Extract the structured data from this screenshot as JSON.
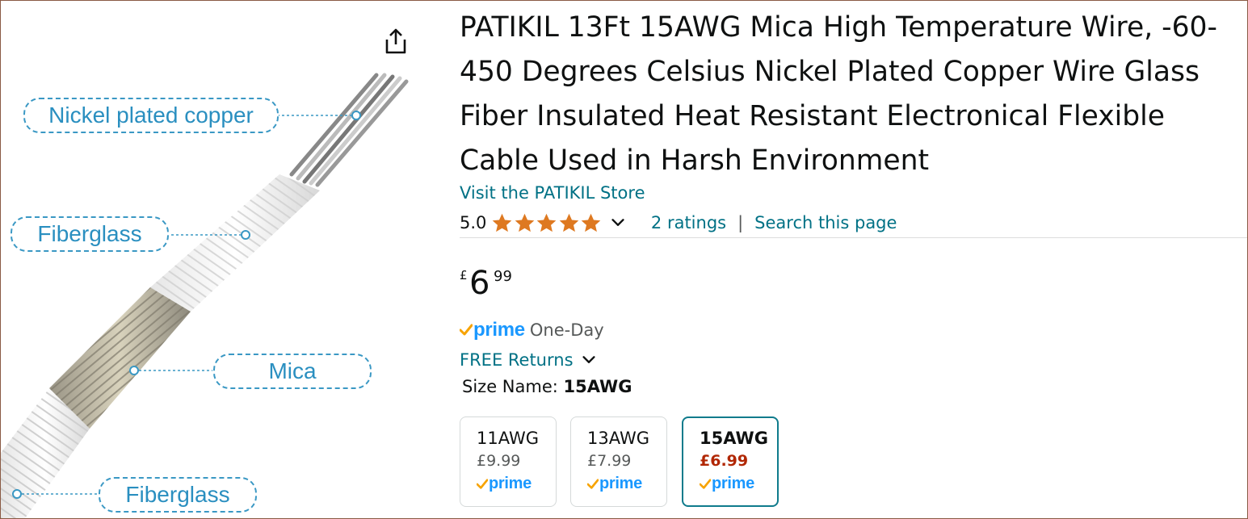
{
  "image": {
    "callouts": [
      {
        "label": "Nickel plated copper"
      },
      {
        "label": "Fiberglass"
      },
      {
        "label": "Mica"
      },
      {
        "label": "Fiberglass"
      }
    ],
    "share_icon": "share-icon"
  },
  "product": {
    "title": "PATIKIL 13Ft 15AWG Mica High Temperature Wire, -60-450 Degrees Celsius Nickel Plated Copper Wire Glass Fiber Insulated Heat Resistant Electronical Flexible Cable Used in Harsh Environment",
    "store_link": "Visit the PATIKIL Store",
    "rating_value": "5.0",
    "stars": 5,
    "ratings_link": "2 ratings",
    "separator": "|",
    "search_link": "Search this page",
    "price": {
      "currency": "£",
      "whole": "6",
      "fraction": "99"
    },
    "prime_word": "prime",
    "delivery": "One-Day",
    "returns": "FREE Returns",
    "size_label": "Size Name:",
    "size_selected": "15AWG",
    "size_options": [
      {
        "name": "11AWG",
        "price": "£9.99",
        "prime": "prime"
      },
      {
        "name": "13AWG",
        "price": "£7.99",
        "prime": "prime"
      },
      {
        "name": "15AWG",
        "price": "£6.99",
        "prime": "prime"
      }
    ]
  },
  "colors": {
    "link": "#007185",
    "star": "#de7921",
    "prime_blue": "#1a98ff",
    "prime_check": "#f7a300",
    "selected_border": "#0f7b8c",
    "selected_price": "#b12704",
    "callout": "#3a98c4"
  }
}
